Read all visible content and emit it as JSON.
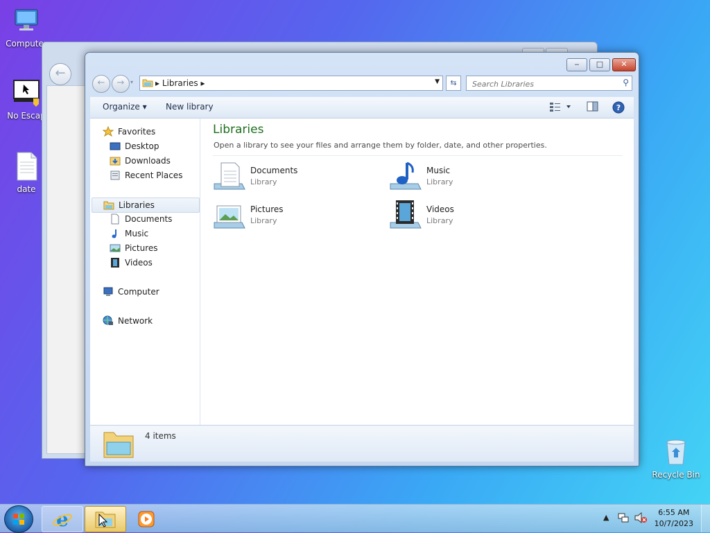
{
  "desktop": {
    "icons": [
      {
        "label": "Computer"
      },
      {
        "label": "No Escap"
      },
      {
        "label": "date"
      },
      {
        "label": "Recycle Bin"
      }
    ]
  },
  "window": {
    "controls": {
      "minimize": "‒",
      "maximize": "□",
      "close": "✕"
    },
    "address": {
      "segments": [
        "Libraries"
      ],
      "text": "Libraries"
    },
    "search": {
      "placeholder": "Search Libraries"
    },
    "toolbar": {
      "organize": "Organize ▾",
      "new_library": "New library"
    },
    "nav": {
      "favorites": {
        "label": "Favorites",
        "items": [
          "Desktop",
          "Downloads",
          "Recent Places"
        ]
      },
      "libraries": {
        "label": "Libraries",
        "items": [
          "Documents",
          "Music",
          "Pictures",
          "Videos"
        ]
      },
      "computer": "Computer",
      "network": "Network"
    },
    "main": {
      "title": "Libraries",
      "description": "Open a library to see your files and arrange them by folder, date, and other properties.",
      "libraries": [
        {
          "name": "Documents",
          "type": "Library",
          "icon": "documents-library-icon"
        },
        {
          "name": "Music",
          "type": "Library",
          "icon": "music-library-icon"
        },
        {
          "name": "Pictures",
          "type": "Library",
          "icon": "pictures-library-icon"
        },
        {
          "name": "Videos",
          "type": "Library",
          "icon": "videos-library-icon"
        }
      ]
    },
    "details": {
      "count": "4 items"
    }
  },
  "taskbar": {
    "clock": {
      "time": "6:55 AM",
      "date": "10/7/2023"
    },
    "pinned": [
      "internet-explorer-icon",
      "windows-explorer-icon",
      "media-player-icon"
    ]
  },
  "colors": {
    "accent_title": "#1e6e1e",
    "selection": "#e2ebf6"
  }
}
